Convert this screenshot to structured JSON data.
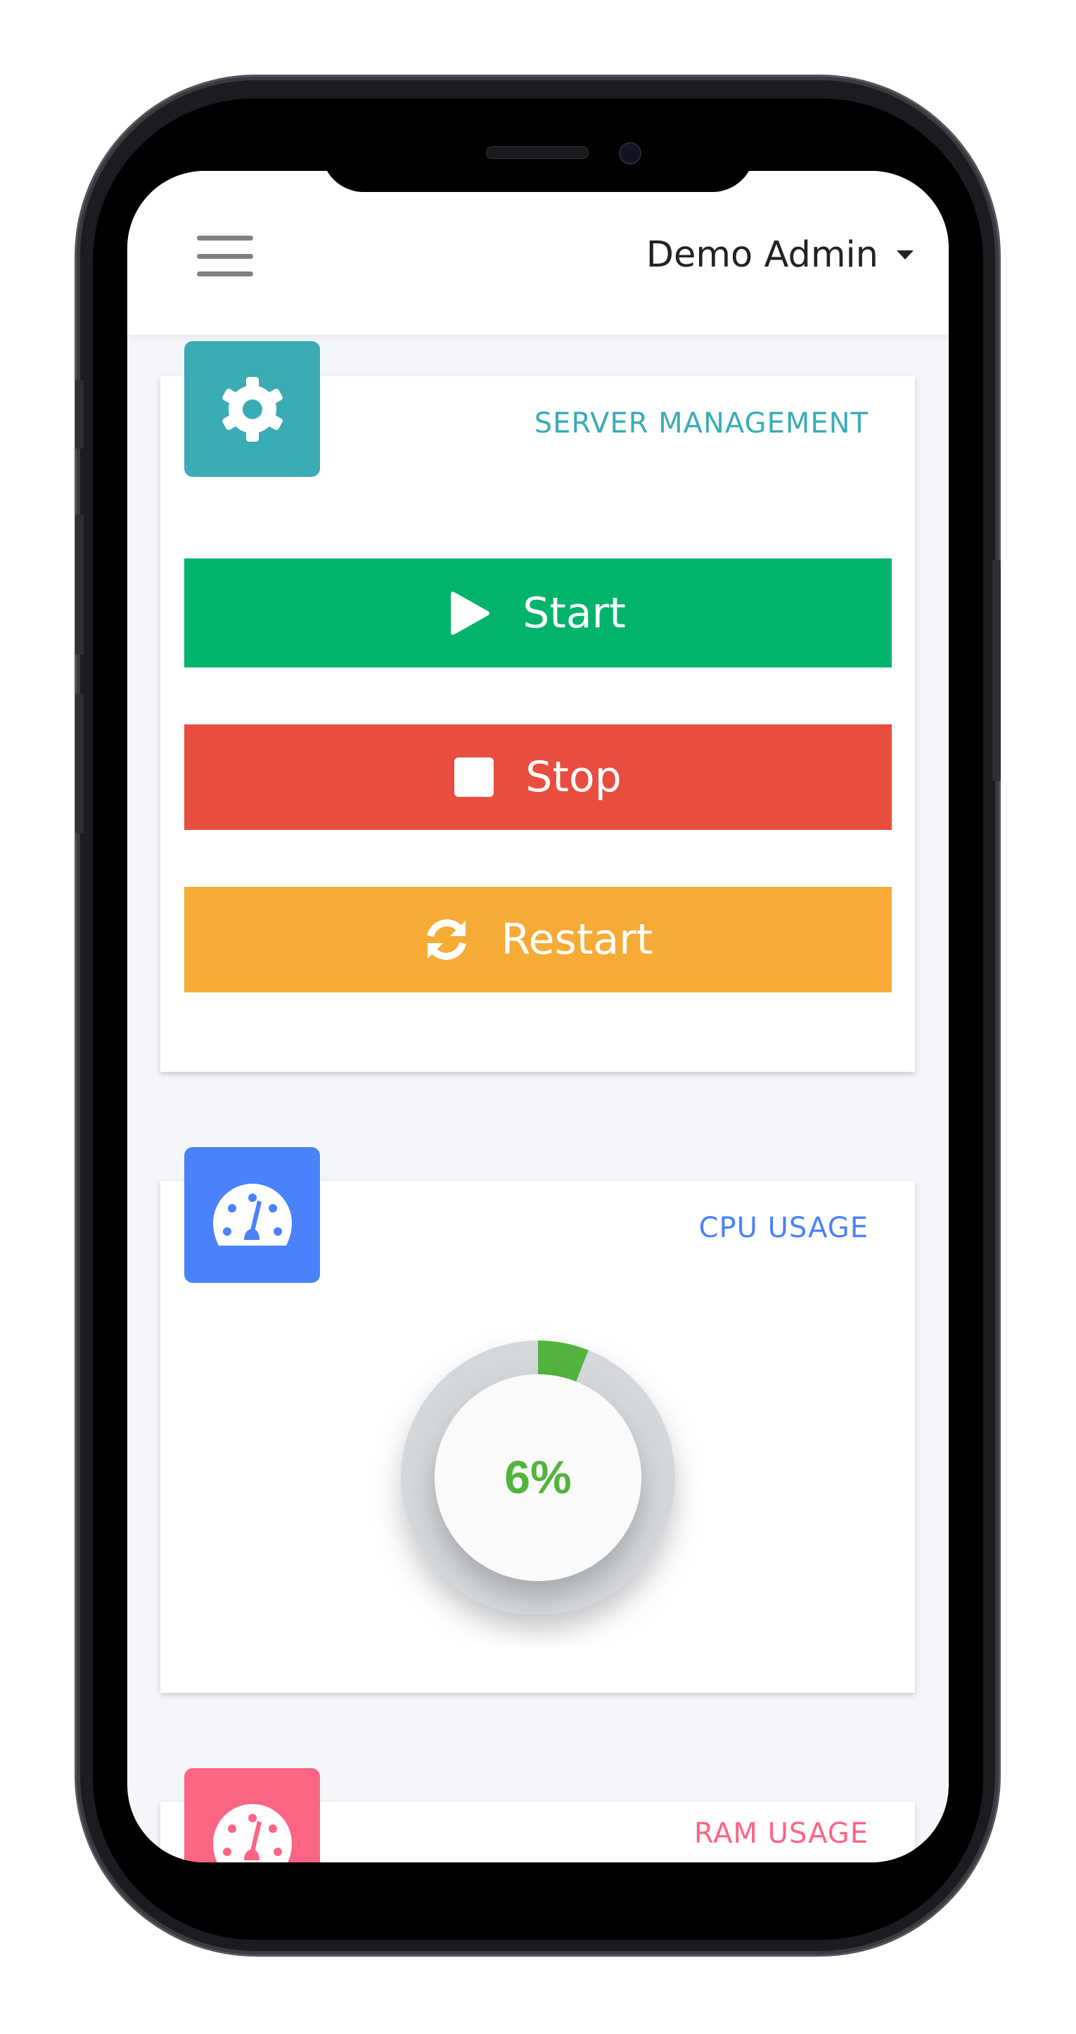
{
  "header": {
    "menu_icon": "hamburger-icon",
    "user_name": "Demo Admin",
    "dropdown_icon": "caret-down-icon"
  },
  "colors": {
    "teal": "#3aacb5",
    "start": "#02b36b",
    "stop": "#e84e3f",
    "restart": "#f5ab36",
    "blue": "#4a82fc",
    "pink": "#fd6584",
    "gauge_fill": "#52b43d",
    "gauge_track": "#d5d8db",
    "background": "#f5f6fa"
  },
  "server_management": {
    "title": "SERVER MANAGEMENT",
    "icon": "gear-icon",
    "buttons": [
      {
        "label": "Start",
        "icon": "play-icon"
      },
      {
        "label": "Stop",
        "icon": "stop-icon"
      },
      {
        "label": "Restart",
        "icon": "sync-icon"
      }
    ]
  },
  "cpu_usage": {
    "title": "CPU USAGE",
    "icon": "tachometer-icon",
    "value_percent": 6,
    "value_label": "6%"
  },
  "ram_usage": {
    "title": "RAM USAGE",
    "icon": "tachometer-icon"
  }
}
